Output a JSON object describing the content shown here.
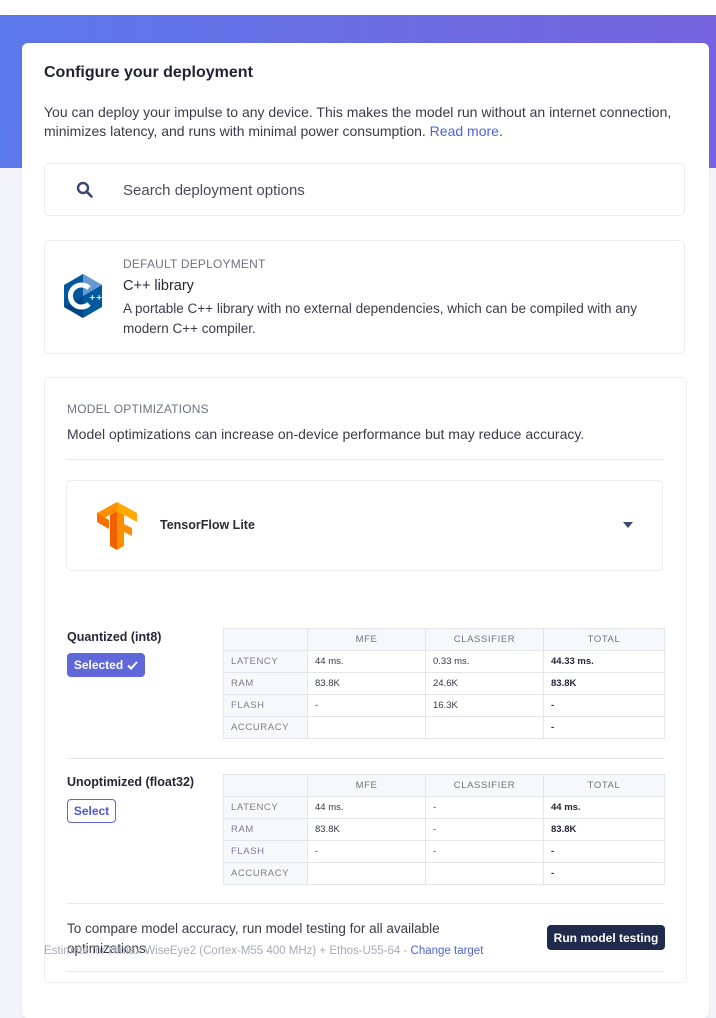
{
  "page": {
    "title": "Configure your deployment",
    "intro_text": "You can deploy your impulse to any device. This makes the model run without an internet connection, minimizes latency, and runs with minimal power consumption.",
    "read_more_label": "Read more",
    "intro_suffix": "."
  },
  "search": {
    "placeholder": "Search deployment options",
    "value": "",
    "icon": "search-icon"
  },
  "default_deployment": {
    "kicker": "DEFAULT DEPLOYMENT",
    "name": "C++ library",
    "description": "A portable C++ library with no external dependencies, which can be compiled with any modern C++ compiler.",
    "icon": "cpp-logo-icon"
  },
  "optimizations": {
    "kicker": "MODEL OPTIMIZATIONS",
    "description": "Model optimizations can increase on-device performance but may reduce accuracy.",
    "engine": {
      "name": "TensorFlow Lite",
      "icon": "tensorflow-logo-icon"
    },
    "columns": [
      "",
      "MFE",
      "CLASSIFIER",
      "TOTAL"
    ],
    "variants": [
      {
        "name": "Quantized (int8)",
        "button_label": "Selected",
        "selected": true,
        "rows": [
          {
            "label": "LATENCY",
            "mfe": "44 ms.",
            "classifier": "0.33 ms.",
            "total": "44.33 ms."
          },
          {
            "label": "RAM",
            "mfe": "83.8K",
            "classifier": "24.6K",
            "total": "83.8K"
          },
          {
            "label": "FLASH",
            "mfe": "-",
            "classifier": "16.3K",
            "total": "-"
          },
          {
            "label": "ACCURACY",
            "mfe": "",
            "classifier": "",
            "total": "-"
          }
        ]
      },
      {
        "name": "Unoptimized (float32)",
        "button_label": "Select",
        "selected": false,
        "rows": [
          {
            "label": "LATENCY",
            "mfe": "44 ms.",
            "classifier": "-",
            "total": "44 ms."
          },
          {
            "label": "RAM",
            "mfe": "83.8K",
            "classifier": "-",
            "total": "83.8K"
          },
          {
            "label": "FLASH",
            "mfe": "-",
            "classifier": "-",
            "total": "-"
          },
          {
            "label": "ACCURACY",
            "mfe": "",
            "classifier": "",
            "total": "-"
          }
        ]
      }
    ],
    "compare_text": "To compare model accuracy, run model testing for all available optimizations.",
    "run_button_label": "Run model testing",
    "estimate_text": "Estimate for Himax WiseEye2 (Cortex-M55 400 MHz) + Ethos-U55-64 - ",
    "change_target_label": "Change target"
  },
  "colors": {
    "banner_start": "#5b78ea",
    "banner_end": "#7763e0",
    "accent": "#5f67d9",
    "link": "#4b63d8",
    "dark_button": "#1f2a4d"
  }
}
